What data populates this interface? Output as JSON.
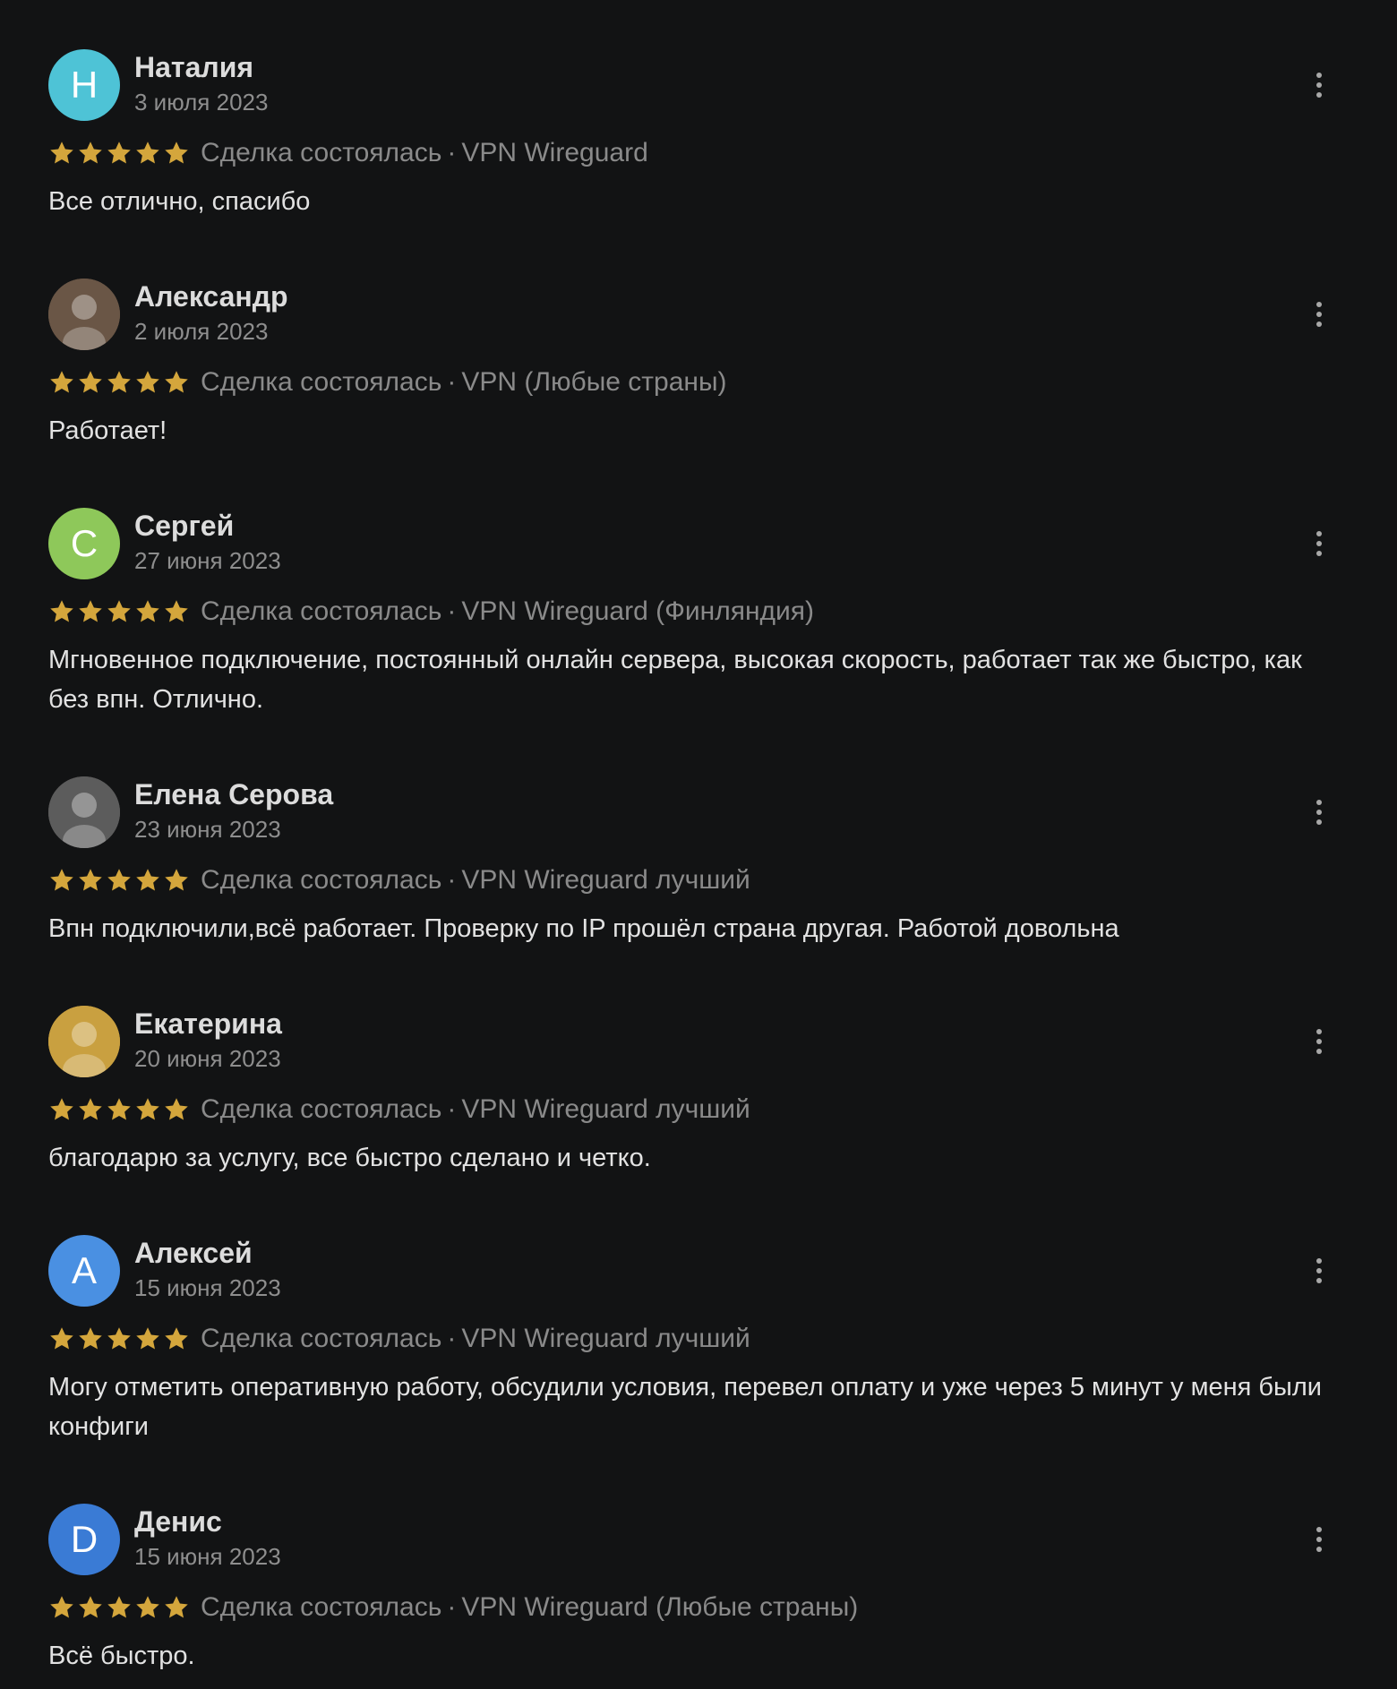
{
  "colors": {
    "background": "#121314",
    "star": "#d4a63c",
    "muted": "#8a8a8a"
  },
  "reviews": [
    {
      "name": "Наталия",
      "date": "3 июля 2023",
      "avatar_letter": "Н",
      "avatar_color": "#4ec3d6",
      "rating": 5,
      "deal": "Сделка состоялась",
      "product": "VPN Wireguard",
      "text": "Все отлично, спасибо"
    },
    {
      "name": "Александр",
      "date": "2 июля 2023",
      "avatar_letter": "",
      "avatar_color": "#6a5646",
      "rating": 5,
      "deal": "Сделка состоялась",
      "product": "VPN (Любые страны)",
      "text": "Работает!"
    },
    {
      "name": "Сергей",
      "date": "27 июня 2023",
      "avatar_letter": "С",
      "avatar_color": "#8ec85a",
      "rating": 5,
      "deal": "Сделка состоялась",
      "product": "VPN Wireguard (Финляндия)",
      "text": "Мгновенное подключение, постоянный онлайн сервера, высокая скорость, работает так же быстро, как без впн. Отлично."
    },
    {
      "name": "Елена Серова",
      "date": "23 июня 2023",
      "avatar_letter": "",
      "avatar_color": "#5c5c5c",
      "rating": 5,
      "deal": "Сделка состоялась",
      "product": "VPN Wireguard лучший",
      "text": "Впн подключили,всё работает. Проверку по IP прошёл страна другая. Работой довольна"
    },
    {
      "name": "Екатерина",
      "date": "20 июня 2023",
      "avatar_letter": "",
      "avatar_color": "#c9a040",
      "rating": 5,
      "deal": "Сделка состоялась",
      "product": "VPN Wireguard лучший",
      "text": "благодарю за услугу, все быстро сделано и четко."
    },
    {
      "name": "Алексей",
      "date": "15 июня 2023",
      "avatar_letter": "А",
      "avatar_color": "#4a90e2",
      "rating": 5,
      "deal": "Сделка состоялась",
      "product": "VPN Wireguard лучший",
      "text": "Могу отметить оперативную работу, обсудили условия, перевел оплату и уже через 5 минут у меня были конфиги"
    },
    {
      "name": "Денис",
      "date": "15 июня 2023",
      "avatar_letter": "D",
      "avatar_color": "#3a7bd5",
      "rating": 5,
      "deal": "Сделка состоялась",
      "product": "VPN Wireguard (Любые страны)",
      "text": "Всё быстро."
    }
  ]
}
